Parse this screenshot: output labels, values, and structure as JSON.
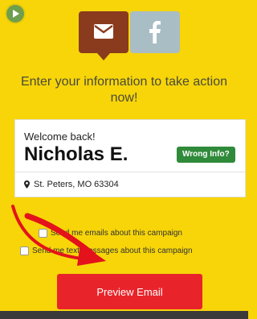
{
  "tabs": {
    "email": {
      "icon": "envelope-icon",
      "color": "#8a3b1e"
    },
    "facebook": {
      "icon": "facebook-icon",
      "color": "#a9bdc4"
    }
  },
  "headline": "Enter your information to take action now!",
  "card": {
    "welcome": "Welcome back!",
    "name": "Nicholas E.",
    "wrong_info": "Wrong Info?",
    "location": "St. Peters, MO 63304"
  },
  "options": {
    "emails": "Send me emails about this campaign",
    "texts": "Send me text messages about this campaign"
  },
  "cta": "Preview Email",
  "colors": {
    "background": "#f7d509",
    "cta": "#e8242a",
    "wrong_info": "#2f8a3a"
  }
}
